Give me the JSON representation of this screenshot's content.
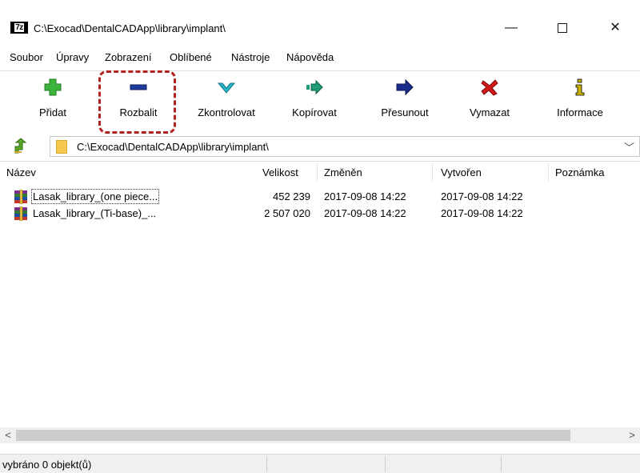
{
  "window": {
    "logo_text": "7z",
    "title": "C:\\Exocad\\DentalCADApp\\library\\implant\\",
    "minimize_glyph": "—",
    "close_glyph": "✕"
  },
  "menu": [
    {
      "label": "Soubor"
    },
    {
      "label": "Úpravy"
    },
    {
      "label": "Zobrazení"
    },
    {
      "label": "Oblíbené"
    },
    {
      "label": "Nástroje"
    },
    {
      "label": "Nápověda"
    }
  ],
  "toolbar": [
    {
      "label": "Přidat",
      "icon": "add-icon"
    },
    {
      "label": "Rozbalit",
      "icon": "extract-icon"
    },
    {
      "label": "Zkontrolovat",
      "icon": "test-icon"
    },
    {
      "label": "Kopírovat",
      "icon": "copy-icon"
    },
    {
      "label": "Přesunout",
      "icon": "move-icon"
    },
    {
      "label": "Vymazat",
      "icon": "delete-icon"
    },
    {
      "label": "Informace",
      "icon": "info-icon"
    }
  ],
  "address": {
    "path": "C:\\Exocad\\DentalCADApp\\library\\implant\\",
    "chevron": "﹀"
  },
  "columns": [
    "Název",
    "Velikost",
    "Změněn",
    "Vytvořen",
    "Poznámka"
  ],
  "files": [
    {
      "name": "Lasak_library_(one piece...",
      "size": "452 239",
      "modified": "2017-09-08 14:22",
      "created": "2017-09-08 14:22",
      "comment": ""
    },
    {
      "name": "Lasak_library_(Ti-base)_...",
      "size": "2 507 020",
      "modified": "2017-09-08 14:22",
      "created": "2017-09-08 14:22",
      "comment": ""
    }
  ],
  "scroll": {
    "left": "<",
    "right": ">"
  },
  "status": {
    "text": "vybráno 0 objekt(ů)"
  },
  "colors": {
    "add": "#3cb43c",
    "extract": "#1e3c9c",
    "test": "#28b4c8",
    "copy": "#1e9c78",
    "move": "#1a2c8c",
    "delete": "#d01818",
    "info": "#c8b400",
    "highlight": "#b32121"
  }
}
